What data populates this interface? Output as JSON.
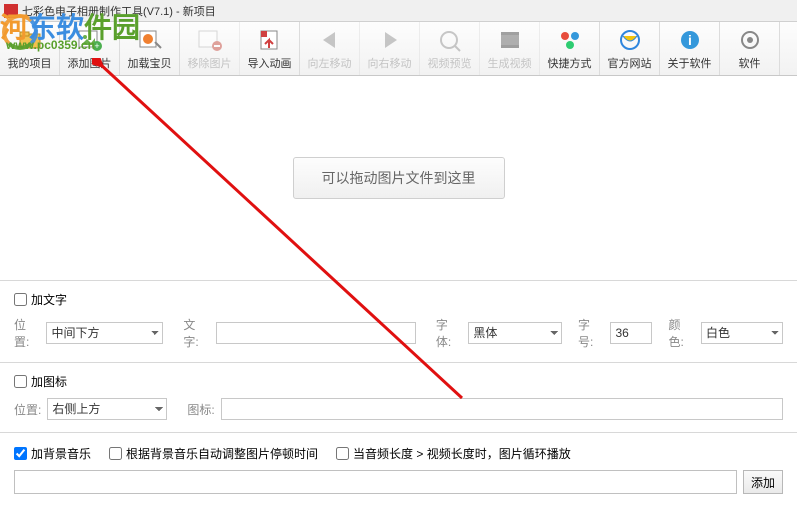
{
  "window": {
    "title": "七彩色电子相册制作工具(V7.1) - 新项目"
  },
  "toolbar": [
    {
      "id": "my-project",
      "label": "我的项目",
      "enabled": true
    },
    {
      "id": "add-image",
      "label": "添加图片",
      "enabled": true
    },
    {
      "id": "load-baby",
      "label": "加载宝贝",
      "enabled": true
    },
    {
      "id": "remove-image",
      "label": "移除图片",
      "enabled": false
    },
    {
      "id": "import-anim",
      "label": "导入动画",
      "enabled": true
    },
    {
      "id": "move-left",
      "label": "向左移动",
      "enabled": false
    },
    {
      "id": "move-right",
      "label": "向右移动",
      "enabled": false
    },
    {
      "id": "video-preview",
      "label": "视频预览",
      "enabled": false
    },
    {
      "id": "gen-video",
      "label": "生成视频",
      "enabled": false
    },
    {
      "id": "shortcut",
      "label": "快捷方式",
      "enabled": true
    },
    {
      "id": "website",
      "label": "官方网站",
      "enabled": true
    },
    {
      "id": "about",
      "label": "关于软件",
      "enabled": true
    },
    {
      "id": "software",
      "label": "软件",
      "enabled": true
    }
  ],
  "dropzone": {
    "hint": "可以拖动图片文件到这里"
  },
  "text_section": {
    "checkbox_label": "加文字",
    "pos_label": "位置:",
    "pos_value": "中间下方",
    "text_label": "文字:",
    "text_value": "",
    "font_label": "字体:",
    "font_value": "黑体",
    "size_label": "字号:",
    "size_value": "36",
    "color_label": "颜色:",
    "color_value": "白色"
  },
  "icon_section": {
    "checkbox_label": "加图标",
    "pos_label": "位置:",
    "pos_value": "右侧上方",
    "icon_label": "图标:",
    "icon_value": ""
  },
  "music_section": {
    "bg_label": "加背景音乐",
    "bg_checked": true,
    "auto_label": "根据背景音乐自动调整图片停顿时间",
    "loop_label": "当音频长度 > 视频长度时，图片循环播放",
    "path_value": "",
    "add_btn": "添加"
  },
  "watermark": {
    "t1": "河",
    "t2": "东软",
    "t3": "件园",
    "sub": "www.pc0359.cn"
  }
}
